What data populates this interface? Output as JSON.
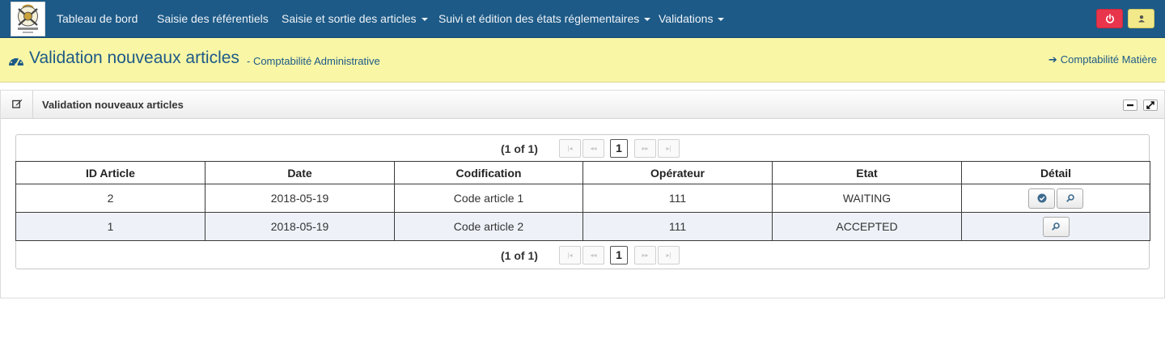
{
  "navbar": {
    "menu": [
      {
        "label": "Tableau de bord",
        "dropdown": false
      },
      {
        "label": "Saisie des référentiels",
        "dropdown": false
      },
      {
        "label": "Saisie et sortie des articles",
        "dropdown": true
      },
      {
        "label": "Suivi et édition des états réglementaires",
        "dropdown": true
      },
      {
        "label": "Validations",
        "dropdown": true
      }
    ],
    "icons": {
      "power": "power-icon",
      "user": "user-icon"
    },
    "colors": {
      "bar": "#1d5a87",
      "power": "#e8354c",
      "user": "#f2ea8a"
    }
  },
  "header": {
    "title": "Validation nouveaux articles",
    "subtitle": "- Comptabilité Administrative",
    "link": "Comptabilité Matière",
    "icon": "dashboard-icon",
    "background": "#f9f6a6"
  },
  "panel": {
    "title": "Validation nouveaux articles",
    "icon": "edit-icon"
  },
  "pager": {
    "current": "(1 of 1)",
    "page": "1",
    "buttons": [
      "first-page",
      "previous-page",
      "next-page",
      "last-page"
    ]
  },
  "table": {
    "columns": [
      "ID Article",
      "Date",
      "Codification",
      "Opérateur",
      "Etat",
      "Détail"
    ],
    "rows": [
      {
        "id": "2",
        "date": "2018-05-19",
        "code": "Code article 1",
        "operator": "111",
        "state": "WAITING",
        "actions": [
          "validate",
          "view"
        ]
      },
      {
        "id": "1",
        "date": "2018-05-19",
        "code": "Code article 2",
        "operator": "111",
        "state": "ACCEPTED",
        "actions": [
          "view"
        ]
      }
    ]
  }
}
